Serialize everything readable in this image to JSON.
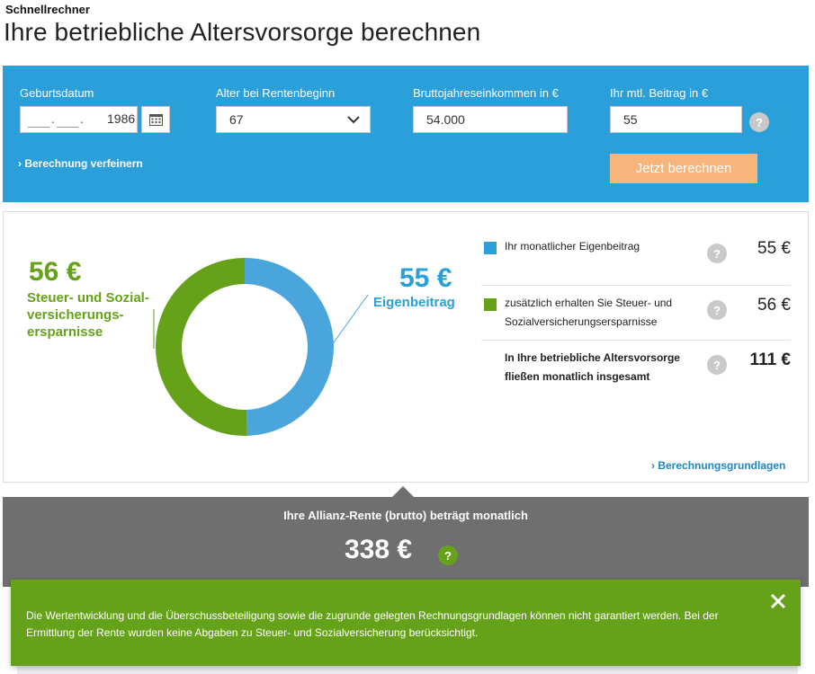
{
  "header": {
    "kicker": "Schnellrechner",
    "title": "Ihre betriebliche Altersvorsorge berechnen"
  },
  "form": {
    "birthdate": {
      "label": "Geburtsdatum",
      "day": "",
      "month": "",
      "year": "1986",
      "calendar_icon": "calendar-icon"
    },
    "retirement_age": {
      "label": "Alter bei Rentenbeginn",
      "value": "67",
      "icon": "chevron-down-icon"
    },
    "gross_income": {
      "label": "Bruttojahreseinkommen in €",
      "value": "54.000"
    },
    "monthly_contribution": {
      "label": "Ihr mtl. Beitrag in €",
      "value": "55",
      "help": "?"
    },
    "refine_link": "› Berechnung verfeinern",
    "calculate_button": "Jetzt berechnen"
  },
  "chart": {
    "green_amount": "56 €",
    "green_caption": "Steuer- und Sozial­versicherungs­ersparnisse",
    "blue_amount": "55 €",
    "blue_caption": "Eigenbeitrag"
  },
  "chart_data": {
    "type": "pie",
    "donut": true,
    "categories": [
      "Eigenbeitrag",
      "Steuer- und Sozialversicherungsersparnisse"
    ],
    "values": [
      55,
      56
    ],
    "colors": [
      "#4aa5dc",
      "#65a21a"
    ]
  },
  "legend": {
    "rows": [
      {
        "text": "Ihr monatlicher Eigenbeitrag",
        "value": "55 €",
        "color": "#2a9fda",
        "help": "?"
      },
      {
        "text": "zusätzlich erhalten Sie Steuer- und Sozialversicherungsersparnisse",
        "value": "56 €",
        "color": "#65a21a",
        "help": "?"
      },
      {
        "text": "In Ihre betriebliche Altersvorsorge fließen monatlich insgesamt",
        "value": "111 €",
        "help": "?"
      }
    ],
    "basis_link": "› Berechnungsgrundlagen"
  },
  "pension": {
    "label": "Ihre Allianz-Rente (brutto) beträgt monatlich",
    "amount": "338 €",
    "help": "?"
  },
  "notice": {
    "text": "Die Wertentwicklung und die Überschussbeteiligung sowie die zugrunde gelegten Rechnungsgrundlagen können nicht garantiert werden. Bei der Ermittlung der Rente wurden keine Abgaben zu Steuer- und Sozialversicherung berücksichtigt.",
    "close_icon": "close-icon"
  },
  "colors": {
    "blue_panel": "#2a9fda",
    "green": "#65a21a",
    "orange_button": "#f8b57b",
    "gray_panel": "#6f6f6f"
  }
}
